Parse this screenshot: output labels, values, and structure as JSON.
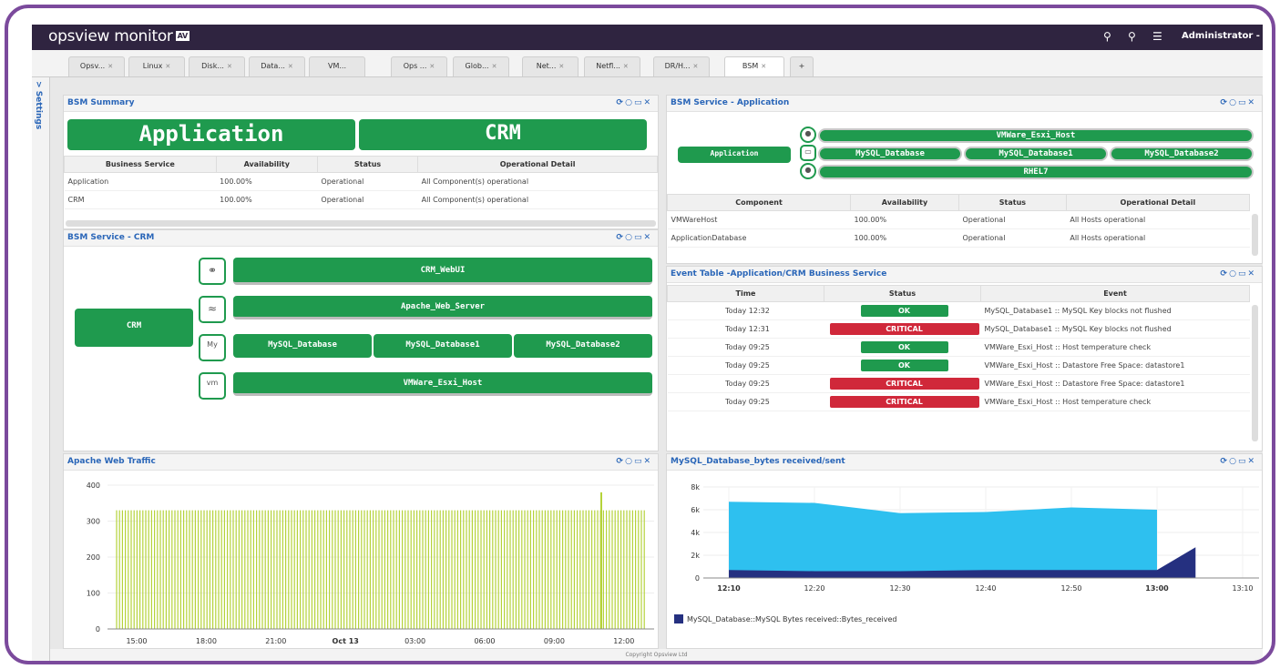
{
  "app": {
    "brand": "opsview monitor",
    "badge": "AV",
    "user": "Administrator -"
  },
  "tabs": [
    "Opsv...",
    "Linux",
    "Disk...",
    "Data...",
    "VM...",
    "Ops ...",
    "Glob...",
    "Net...",
    "Netfl...",
    "DR/H...",
    "BSM",
    "+"
  ],
  "settings_label": "Settings",
  "bsm_summary": {
    "title": "BSM Summary",
    "big_left": "Application",
    "big_right": "CRM",
    "columns": [
      "Business Service",
      "Availability",
      "Status",
      "Operational Detail"
    ],
    "rows": [
      [
        "Application",
        "100.00%",
        "Operational",
        "All Component(s) operational"
      ],
      [
        "CRM",
        "100.00%",
        "Operational",
        "All Component(s) operational"
      ]
    ]
  },
  "bsm_crm": {
    "title": "BSM Service - CRM",
    "root": "CRM",
    "nodes": [
      "CRM_WebUI",
      "Apache_Web_Server",
      "MySQL_Database",
      "MySQL_Database1",
      "MySQL_Database2",
      "VMWare_Esxi_Host"
    ],
    "icon_vm": "vm"
  },
  "bsm_app": {
    "title": "BSM Service - Application",
    "root": "Application",
    "nodes": [
      "VMWare_Esxi_Host",
      "MySQL_Database",
      "MySQL_Database1",
      "MySQL_Database2",
      "RHEL7"
    ],
    "columns": [
      "Component",
      "Availability",
      "Status",
      "Operational Detail"
    ],
    "rows": [
      [
        "VMWareHost",
        "100.00%",
        "Operational",
        "All Hosts operational"
      ],
      [
        "ApplicationDatabase",
        "100.00%",
        "Operational",
        "All Hosts operational"
      ]
    ]
  },
  "events": {
    "title": "Event Table -Application/CRM Business Service",
    "columns": [
      "Time",
      "Status",
      "Event"
    ],
    "rows": [
      {
        "time": "Today 12:32",
        "status": "OK",
        "event": "MySQL_Database1 :: MySQL Key blocks not flushed"
      },
      {
        "time": "Today 12:31",
        "status": "CRITICAL",
        "event": "MySQL_Database1 :: MySQL Key blocks not flushed"
      },
      {
        "time": "Today 09:25",
        "status": "OK",
        "event": "VMWare_Esxi_Host :: Host temperature check"
      },
      {
        "time": "Today 09:25",
        "status": "OK",
        "event": "VMWare_Esxi_Host :: Datastore Free Space: datastore1"
      },
      {
        "time": "Today 09:25",
        "status": "CRITICAL",
        "event": "VMWare_Esxi_Host :: Datastore Free Space: datastore1"
      },
      {
        "time": "Today 09:25",
        "status": "CRITICAL",
        "event": "VMWare_Esxi_Host :: Host temperature check"
      }
    ],
    "status_colors": {
      "OK": "#1f9a4e",
      "CRITICAL": "#d0283a"
    }
  },
  "apache": {
    "title": "Apache Web Traffic"
  },
  "mysql": {
    "title": "MySQL_Database_bytes received/sent",
    "legend": "MySQL_Database::MySQL Bytes received::Bytes_received"
  },
  "footer": "Copyright Opsview Ltd",
  "chart_data": [
    {
      "type": "bar",
      "title": "Apache Web Traffic",
      "x_ticks": [
        "15:00",
        "18:00",
        "21:00",
        "Oct 13",
        "03:00",
        "06:00",
        "09:00",
        "12:00"
      ],
      "y_ticks": [
        0,
        100,
        200,
        300,
        400
      ],
      "ylim": [
        0,
        400
      ],
      "series": [
        {
          "value": 330,
          "spike": 380,
          "color": "#b5d33a"
        }
      ]
    },
    {
      "type": "area",
      "title": "MySQL_Database_bytes received/sent",
      "x": [
        "12:10",
        "12:20",
        "12:30",
        "12:40",
        "12:50",
        "13:00",
        "13:10"
      ],
      "y_ticks": [
        "0",
        "2k",
        "4k",
        "6k",
        "8k"
      ],
      "ylim": [
        0,
        8000
      ],
      "series": [
        {
          "name": "MySQL_Database::MySQL Bytes received::Bytes_received",
          "color": "#253080",
          "values": [
            700,
            600,
            600,
            700,
            700,
            700,
            2700
          ]
        },
        {
          "color": "#2ec0ef",
          "values": [
            6700,
            6600,
            5700,
            5800,
            6200,
            6000
          ]
        }
      ]
    }
  ]
}
